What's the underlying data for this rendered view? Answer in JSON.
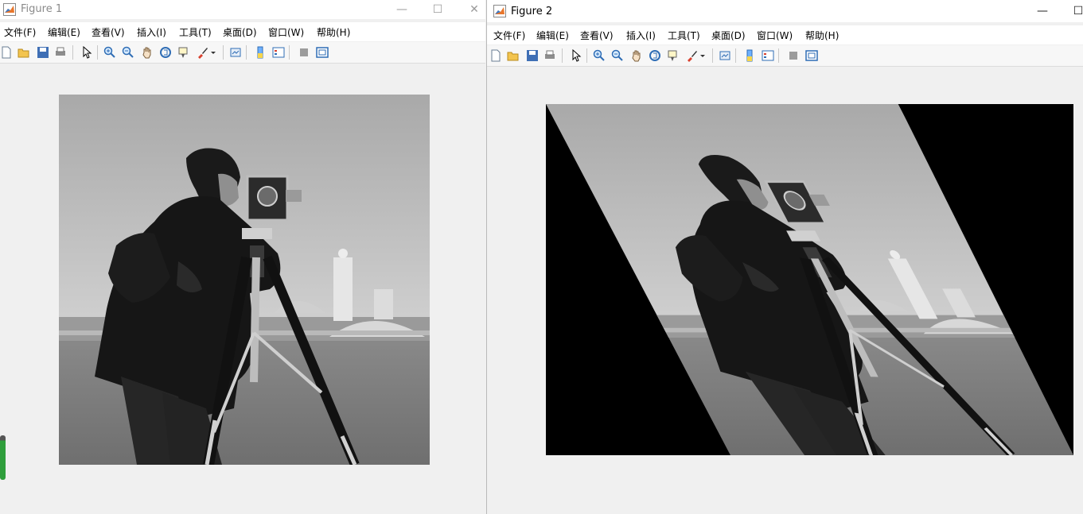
{
  "figure1": {
    "title": "Figure 1",
    "menu": [
      "文件(F)",
      "编辑(E)",
      "查看(V)",
      "插入(I)",
      "工具(T)",
      "桌面(D)",
      "窗口(W)",
      "帮助(H)"
    ]
  },
  "figure2": {
    "title": "Figure 2",
    "menu": [
      "文件(F)",
      "编辑(E)",
      "查看(V)",
      "插入(I)",
      "工具(T)",
      "桌面(D)",
      "窗口(W)",
      "帮助(H)"
    ]
  },
  "window_controls": {
    "minimize": "—",
    "maximize": "☐",
    "close": "✕"
  },
  "images": {
    "original": "cameraman",
    "transformed": "cameraman (sheared)"
  },
  "colors": {
    "titlebar": "#ffffff",
    "client": "#f0f0f0",
    "toolbar": "#f7f7f7"
  }
}
